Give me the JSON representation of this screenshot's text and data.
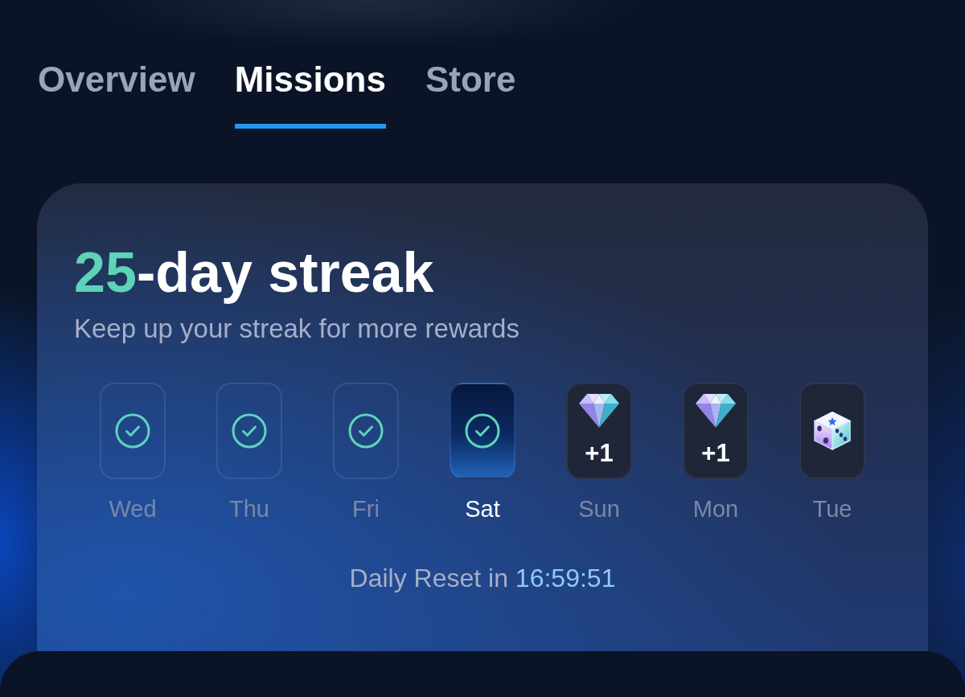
{
  "tabs": [
    {
      "label": "Overview",
      "selected": false
    },
    {
      "label": "Missions",
      "selected": true
    },
    {
      "label": "Store",
      "selected": false
    }
  ],
  "streak": {
    "count": "25",
    "title_rest": "-day streak",
    "subtitle": "Keep up your streak for more rewards"
  },
  "days": [
    {
      "label": "Wed",
      "kind": "check",
      "selected": false
    },
    {
      "label": "Thu",
      "kind": "check",
      "selected": false
    },
    {
      "label": "Fri",
      "kind": "check",
      "selected": false
    },
    {
      "label": "Sat",
      "kind": "check",
      "selected": true
    },
    {
      "label": "Sun",
      "kind": "gem",
      "reward": "+1",
      "selected": false
    },
    {
      "label": "Mon",
      "kind": "gem",
      "reward": "+1",
      "selected": false
    },
    {
      "label": "Tue",
      "kind": "dice",
      "selected": false
    }
  ],
  "reset": {
    "label": "Daily Reset in",
    "time": "16:59:51"
  }
}
